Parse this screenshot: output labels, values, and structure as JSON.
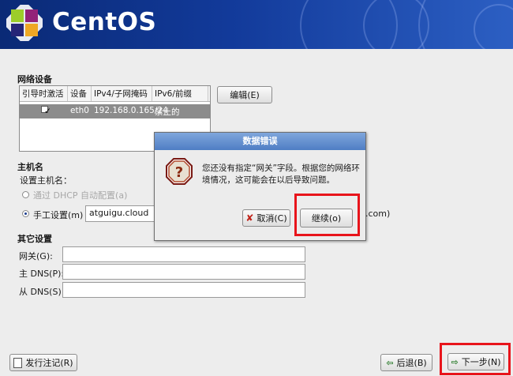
{
  "banner": {
    "logo_text": "CentOS"
  },
  "network": {
    "section_title": "网络设备",
    "columns": [
      "引导时激活",
      "设备",
      "IPv4/子网掩码",
      "IPv6/前缀"
    ],
    "row": {
      "active": "✓",
      "device": "eth0",
      "ipv4": "192.168.0.165/24",
      "ipv6": "禁止的"
    },
    "edit_button": "编辑(E)"
  },
  "hostname": {
    "section_title": "主机名",
    "set_label": "设置主机名：",
    "dhcp_option": "通过 DHCP 自动配置(a)",
    "manual_option": "手工设置(m)",
    "manual_value": "atguigu.cloud",
    "example_suffix": ".com)"
  },
  "other": {
    "section_title": "其它设置",
    "gateway_label": "网关(G):",
    "dns1_label": "主 DNS(P):",
    "dns2_label": "从 DNS(S):"
  },
  "dialog": {
    "title": "数据错误",
    "message": "您还没有指定“网关”字段。根据您的网络环境情况，这可能会在以后导致问题。",
    "cancel_button": "取消(C)",
    "continue_button": "继续(o)"
  },
  "footer": {
    "release_notes_button": "发行注记(R)",
    "back_button": "后退(B)",
    "next_button": "下一步(N)"
  },
  "colors": {
    "highlight": "#e8141b",
    "banner": "#123a9a"
  }
}
